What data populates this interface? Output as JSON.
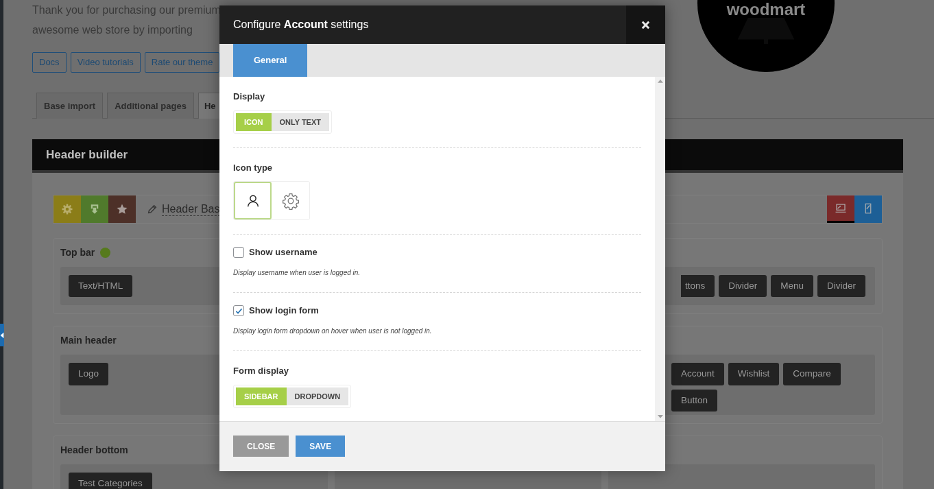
{
  "intro": {
    "lines": [
      "Thank you for purchasing our premium",
      "awesome web store by importing"
    ],
    "links": [
      "Docs",
      "Video tutorials",
      "Rate our theme"
    ]
  },
  "logo": {
    "text": "woodmart"
  },
  "tabs": [
    {
      "label": "Base import",
      "selected": false
    },
    {
      "label": "Additional pages",
      "selected": false
    },
    {
      "label": "He",
      "selected": true
    }
  ],
  "builder": {
    "title": "Header builder",
    "header_name": "Header Bas",
    "devices": [
      {
        "kind": "desktop",
        "selected": true
      },
      {
        "kind": "mobile",
        "selected": false
      }
    ],
    "rows": [
      {
        "title": "Top bar",
        "active": true,
        "left": [
          "Text/HTML"
        ],
        "right": [
          "ttons",
          "Divider",
          "Menu",
          "Divider"
        ]
      },
      {
        "title": "Main header",
        "active": false,
        "left": [
          "Logo"
        ],
        "right": [
          "Account",
          "Wishlist",
          "Compare",
          "Button"
        ]
      },
      {
        "title": "Header bottom",
        "active": false,
        "left": [
          "Test Categories"
        ],
        "right": []
      }
    ]
  },
  "modal": {
    "title": "Configure **Account** settings",
    "tabs": [
      {
        "label": "General",
        "selected": true
      }
    ],
    "fields": [
      {
        "kind": "toggle",
        "label": "Display",
        "options": [
          {
            "label": "ICON",
            "selected": true
          },
          {
            "label": "ONLY TEXT",
            "selected": false
          }
        ]
      },
      {
        "kind": "icons",
        "label": "Icon type",
        "options": [
          {
            "kind": "person",
            "selected": true
          },
          {
            "kind": "gear",
            "selected": false
          }
        ]
      },
      {
        "kind": "checkbox",
        "label": "Show username",
        "checked": false,
        "description": "Display username when user is logged in."
      },
      {
        "kind": "checkbox",
        "label": "Show login form",
        "checked": true,
        "description": "Display login form dropdown on hover when user is not logged in."
      },
      {
        "kind": "toggle",
        "label": "Form display",
        "options": [
          {
            "label": "SIDEBAR",
            "selected": true
          },
          {
            "label": "DROPDOWN",
            "selected": false
          }
        ]
      }
    ],
    "buttons": [
      {
        "label": "CLOSE",
        "kind": "secondary"
      },
      {
        "label": "SAVE",
        "kind": "primary"
      }
    ]
  }
}
